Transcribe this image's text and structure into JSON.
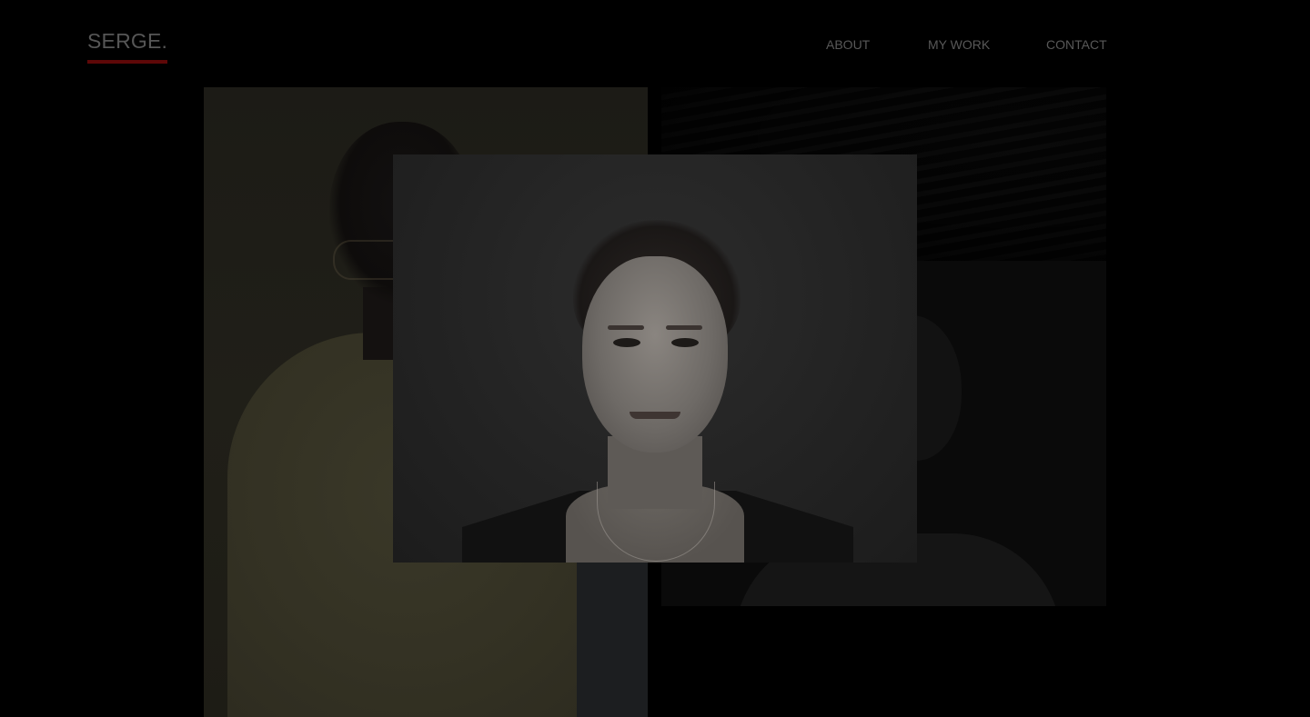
{
  "header": {
    "logo": "SERGE.",
    "nav": {
      "about": "ABOUT",
      "my_work": "MY WORK",
      "contact": "CONTACT"
    }
  },
  "colors": {
    "background": "#000000",
    "logo_underline": "#5e0808",
    "nav_text": "#585858"
  },
  "gallery": {
    "photos": [
      {
        "subject": "man-in-cream-sweater-portrait"
      },
      {
        "subject": "dark-striped-photo"
      },
      {
        "subject": "woman-portrait-background"
      },
      {
        "subject": "woman-portrait-foreground"
      }
    ]
  }
}
